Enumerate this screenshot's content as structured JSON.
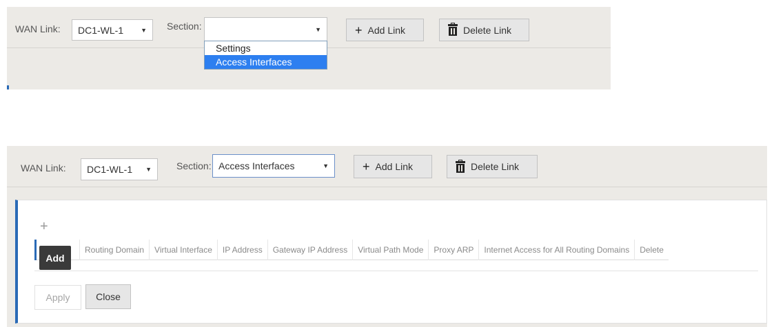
{
  "top_toolbar": {
    "wan_link_label": "WAN Link:",
    "wan_link_value": "DC1-WL-1",
    "section_label": "Section:",
    "section_value": "",
    "add_link_label": "Add Link",
    "delete_link_label": "Delete Link"
  },
  "section_dropdown": {
    "options": [
      "Settings",
      "Access Interfaces"
    ],
    "highlighted": "Access Interfaces"
  },
  "bottom_toolbar": {
    "wan_link_label": "WAN Link:",
    "wan_link_value": "DC1-WL-1",
    "section_label": "Section:",
    "section_value": "Access Interfaces",
    "add_link_label": "Add Link",
    "delete_link_label": "Delete Link"
  },
  "access_interfaces": {
    "add_icon": "+",
    "tooltip": "Add",
    "columns": [
      "Routing Domain",
      "Virtual Interface",
      "IP Address",
      "Gateway IP Address",
      "Virtual Path Mode",
      "Proxy ARP",
      "Internet Access for All Routing Domains",
      "Delete"
    ],
    "apply_label": "Apply",
    "close_label": "Close"
  },
  "icons": {
    "plus": "plus-icon",
    "trash": "trash-icon",
    "caret": "caret-down-icon"
  },
  "colors": {
    "accent": "#2a6ab6",
    "selected_option": "#2d7ff0",
    "toolbar_bg": "#eceae6"
  }
}
